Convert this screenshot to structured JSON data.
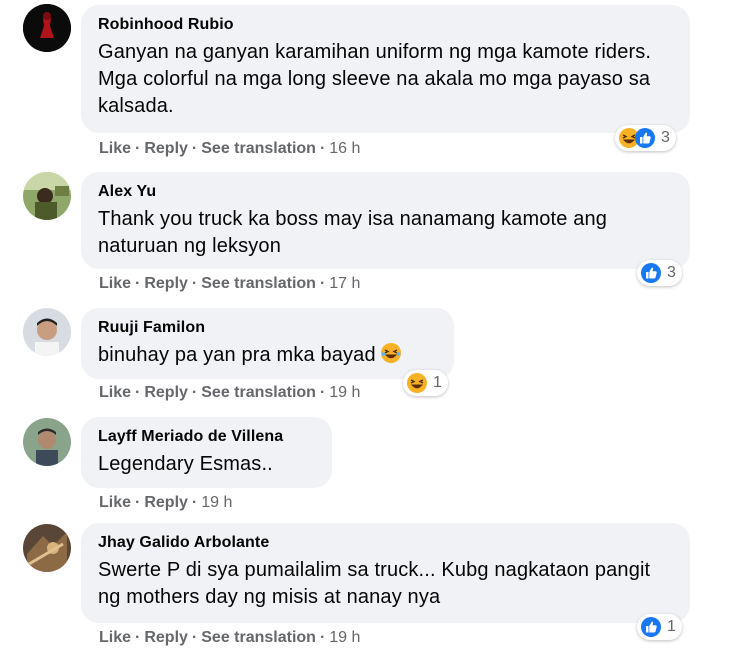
{
  "actions": {
    "like": "Like",
    "reply": "Reply",
    "translate": "See translation",
    "separator": "·"
  },
  "comments": [
    {
      "author": "Robinhood Rubio",
      "text": "Ganyan na ganyan karamihan uniform ng mga kamote riders. Mga colorful na mga long sleeve na akala mo mga payaso sa kalsada.",
      "time": "16 h",
      "reaction_count": "3",
      "reactions": [
        "haha-icon",
        "like-icon"
      ]
    },
    {
      "author": "Alex Yu",
      "text": "Thank you truck ka boss may isa nanamang kamote ang naturuan ng leksyon",
      "time": "17 h",
      "reaction_count": "3",
      "reactions": [
        "like-icon"
      ]
    },
    {
      "author": "Ruuji Familon",
      "text": "binuhay pa yan pra mka bayad",
      "time": "19 h",
      "reaction_count": "1",
      "reactions": [
        "haha-icon"
      ]
    },
    {
      "author": "Layff Meriado de Villena",
      "text": "Legendary Esmas..",
      "time": "19 h",
      "reaction_count": "",
      "reactions": []
    },
    {
      "author": "Jhay Galido Arbolante",
      "text": "Swerte P di sya pumailalim sa truck... Kubg nagkataon pangit ng mothers day ng misis at nanay nya",
      "time": "19 h",
      "reaction_count": "1",
      "reactions": [
        "like-icon"
      ]
    }
  ],
  "colors": {
    "bubble": "#f0f2f5",
    "meta": "#65676b",
    "like_blue": "#1877f2",
    "haha_yellow": "#f7b125"
  }
}
